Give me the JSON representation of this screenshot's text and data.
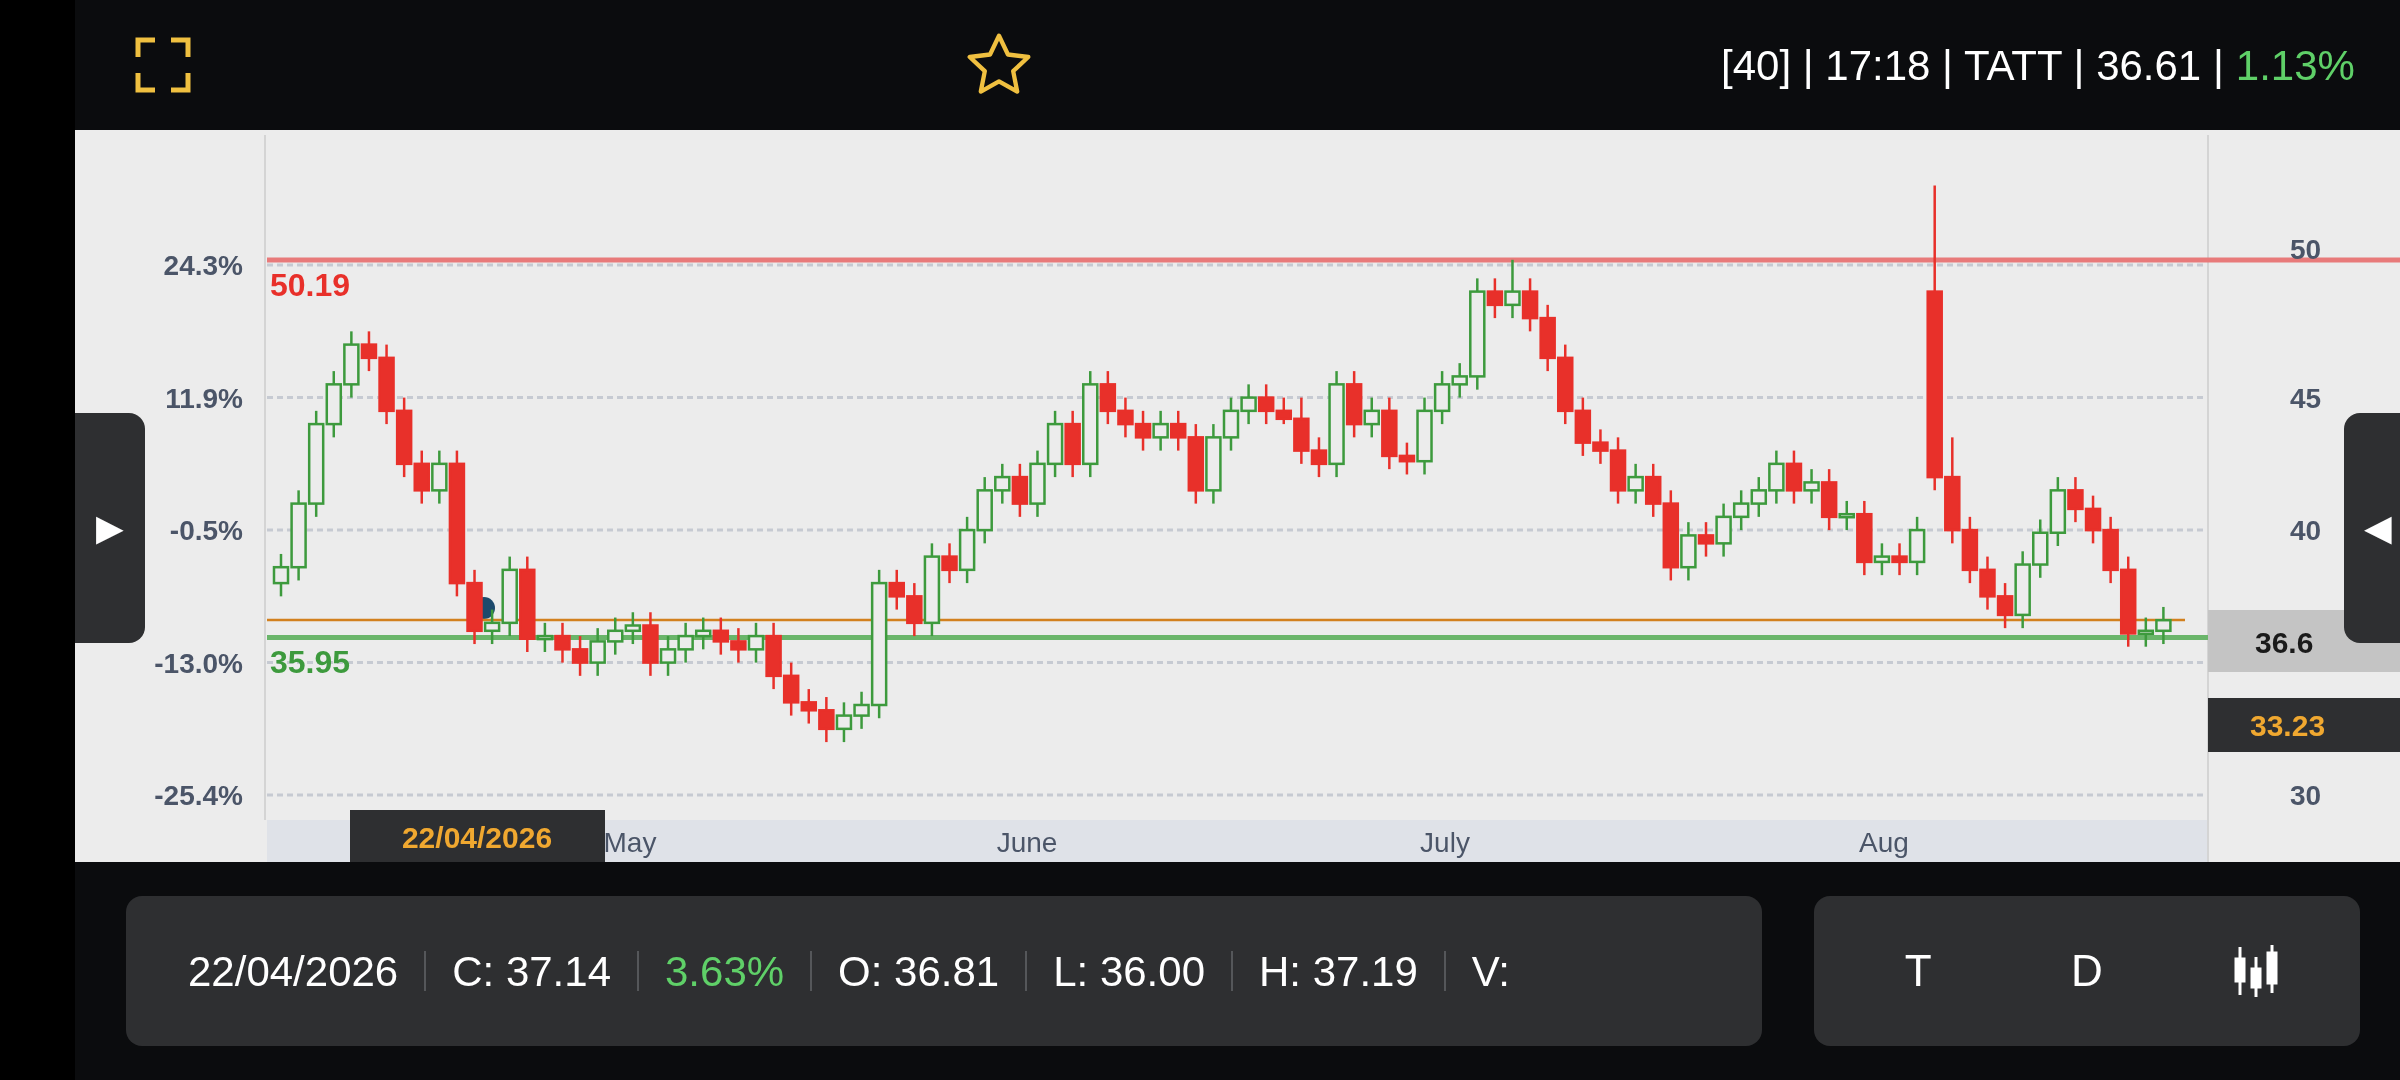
{
  "header": {
    "quote": "[40] | 17:18 | TATT | 36.61 |",
    "change": "1.13%"
  },
  "chart": {
    "left_axis": [
      "24.3%",
      "11.9%",
      "-0.5%",
      "-13.0%",
      "-25.4%"
    ],
    "right_axis": [
      "50",
      "45",
      "40",
      "30"
    ],
    "months": [
      "May",
      "June",
      "July",
      "Aug"
    ],
    "price_tag": "36.6",
    "marker_tag": "33.23",
    "cursor_date": "22/04/2026",
    "left_handle": "▶",
    "right_handle": "◀",
    "chart_data": {
      "type": "candlestick",
      "ylim": [
        29.06,
        54.91
      ],
      "yticks": [
        50,
        45,
        40,
        30
      ],
      "grid": true,
      "ref_lines": [
        {
          "axis": "y",
          "value": 50.19,
          "label": "50.19",
          "color": "#e87a7a"
        },
        {
          "axis": "y",
          "value": 36.61,
          "color": "#d2801e"
        },
        {
          "axis": "y",
          "value": 35.95,
          "label": "35.95",
          "color": "#6ab56a"
        }
      ],
      "ohlc": [
        [
          38,
          39.1,
          37.5,
          38.6
        ],
        [
          38.6,
          41.5,
          38.1,
          41
        ],
        [
          41,
          44.5,
          40.5,
          44
        ],
        [
          44,
          46,
          43.5,
          45.5
        ],
        [
          45.5,
          47.5,
          45,
          47
        ],
        [
          47,
          47.5,
          46,
          46.5
        ],
        [
          46.5,
          47,
          44,
          44.5
        ],
        [
          44.5,
          45,
          42,
          42.5
        ],
        [
          42.5,
          43,
          41,
          41.5
        ],
        [
          41.5,
          43,
          41,
          42.5
        ],
        [
          42.5,
          43,
          37.5,
          38
        ],
        [
          38,
          38.5,
          35.7,
          36.2
        ],
        [
          36.2,
          37,
          35.7,
          36.5
        ],
        [
          36.5,
          39,
          36,
          38.5
        ],
        [
          38.5,
          39,
          35.4,
          35.9
        ],
        [
          35.9,
          36.5,
          35.4,
          36
        ],
        [
          36,
          36.5,
          35,
          35.5
        ],
        [
          35.5,
          36,
          34.5,
          35
        ],
        [
          35,
          36.3,
          34.5,
          35.8
        ],
        [
          35.8,
          36.7,
          35.3,
          36.2
        ],
        [
          36.2,
          36.9,
          35.7,
          36.4
        ],
        [
          36.4,
          36.9,
          34.5,
          35
        ],
        [
          35,
          36,
          34.5,
          35.5
        ],
        [
          35.5,
          36.5,
          35,
          36
        ],
        [
          36,
          36.7,
          35.5,
          36.2
        ],
        [
          36.2,
          36.7,
          35.3,
          35.8
        ],
        [
          35.8,
          36.3,
          35,
          35.5
        ],
        [
          35.5,
          36.5,
          35,
          36
        ],
        [
          36,
          36.5,
          34,
          34.5
        ],
        [
          34.5,
          35,
          33,
          33.5
        ],
        [
          33.5,
          34,
          32.7,
          33.2
        ],
        [
          33.2,
          33.7,
          32,
          32.5
        ],
        [
          32.5,
          33.5,
          32,
          33
        ],
        [
          33,
          33.9,
          32.5,
          33.4
        ],
        [
          33.4,
          38.5,
          32.9,
          38
        ],
        [
          38,
          38.5,
          37,
          37.5
        ],
        [
          37.5,
          38,
          36,
          36.5
        ],
        [
          36.5,
          39.5,
          36,
          39
        ],
        [
          39,
          39.5,
          38,
          38.5
        ],
        [
          38.5,
          40.5,
          38,
          40
        ],
        [
          40,
          42,
          39.5,
          41.5
        ],
        [
          41.5,
          42.5,
          41,
          42
        ],
        [
          42,
          42.5,
          40.5,
          41
        ],
        [
          41,
          43,
          40.5,
          42.5
        ],
        [
          42.5,
          44.5,
          42,
          44
        ],
        [
          44,
          44.5,
          42,
          42.5
        ],
        [
          42.5,
          46,
          42,
          45.5
        ],
        [
          45.5,
          46,
          44,
          44.5
        ],
        [
          44.5,
          45,
          43.5,
          44
        ],
        [
          44,
          44.5,
          43,
          43.5
        ],
        [
          43.5,
          44.5,
          43,
          44
        ],
        [
          44,
          44.5,
          43,
          43.5
        ],
        [
          43.5,
          44,
          41,
          41.5
        ],
        [
          41.5,
          44,
          41,
          43.5
        ],
        [
          43.5,
          45,
          43,
          44.5
        ],
        [
          44.5,
          45.5,
          44,
          45
        ],
        [
          45,
          45.5,
          44,
          44.5
        ],
        [
          44.5,
          45,
          44,
          44.2
        ],
        [
          44.2,
          45,
          42.5,
          43
        ],
        [
          43,
          43.5,
          42,
          42.5
        ],
        [
          42.5,
          46,
          42,
          45.5
        ],
        [
          45.5,
          46,
          43.5,
          44
        ],
        [
          44,
          45,
          43.5,
          44.5
        ],
        [
          44.5,
          45,
          42.3,
          42.8
        ],
        [
          42.8,
          43.3,
          42.1,
          42.6
        ],
        [
          42.6,
          45,
          42.1,
          44.5
        ],
        [
          44.5,
          46,
          44,
          45.5
        ],
        [
          45.5,
          46.3,
          45,
          45.8
        ],
        [
          45.8,
          49.5,
          45.3,
          49
        ],
        [
          49,
          49.5,
          48,
          48.5
        ],
        [
          48.5,
          50.2,
          48,
          49
        ],
        [
          49,
          49.5,
          47.5,
          48
        ],
        [
          48,
          48.5,
          46,
          46.5
        ],
        [
          46.5,
          47,
          44,
          44.5
        ],
        [
          44.5,
          45,
          42.8,
          43.3
        ],
        [
          43.3,
          43.8,
          42.5,
          43
        ],
        [
          43,
          43.5,
          41,
          41.5
        ],
        [
          41.5,
          42.5,
          41,
          42
        ],
        [
          42,
          42.5,
          40.5,
          41
        ],
        [
          41,
          41.5,
          38.1,
          38.6
        ],
        [
          38.6,
          40.3,
          38.1,
          39.8
        ],
        [
          39.8,
          40.3,
          39,
          39.5
        ],
        [
          39.5,
          41,
          39,
          40.5
        ],
        [
          40.5,
          41.5,
          40,
          41
        ],
        [
          41,
          42,
          40.5,
          41.5
        ],
        [
          41.5,
          43,
          41,
          42.5
        ],
        [
          42.5,
          43,
          41,
          41.5
        ],
        [
          41.5,
          42.3,
          41,
          41.8
        ],
        [
          41.8,
          42.3,
          40,
          40.5
        ],
        [
          40.5,
          41.1,
          40,
          40.6
        ],
        [
          40.6,
          41.1,
          38.3,
          38.8
        ],
        [
          38.8,
          39.5,
          38.3,
          39
        ],
        [
          39,
          39.5,
          38.3,
          38.8
        ],
        [
          38.8,
          40.5,
          38.3,
          40
        ],
        [
          49,
          53,
          41.5,
          42
        ],
        [
          42,
          43.5,
          39.5,
          40
        ],
        [
          40,
          40.5,
          38,
          38.5
        ],
        [
          38.5,
          39,
          37,
          37.5
        ],
        [
          37.5,
          38,
          36.3,
          36.8
        ],
        [
          36.8,
          39.2,
          36.3,
          38.7
        ],
        [
          38.7,
          40.4,
          38.2,
          39.9
        ],
        [
          39.9,
          42,
          39.4,
          41.5
        ],
        [
          41.5,
          42,
          40.3,
          40.8
        ],
        [
          40.8,
          41.3,
          39.5,
          40
        ],
        [
          40,
          40.5,
          38,
          38.5
        ],
        [
          38.5,
          39,
          35.6,
          36.1
        ],
        [
          36.1,
          36.7,
          35.6,
          36.2
        ],
        [
          36.2,
          37.1,
          35.7,
          36.6
        ]
      ]
    }
  },
  "info_bar": [
    {
      "kind": "value",
      "text": "22/04/2026"
    },
    {
      "kind": "value",
      "text": "C: 37.14"
    },
    {
      "kind": "change",
      "text": "3.63%"
    },
    {
      "kind": "value",
      "text": "O: 36.81"
    },
    {
      "kind": "value",
      "text": "L: 36.00"
    },
    {
      "kind": "value",
      "text": "H: 37.19"
    },
    {
      "kind": "value",
      "text": "V:"
    }
  ],
  "buttons": [
    {
      "kind": "text",
      "label": "T"
    },
    {
      "kind": "text",
      "label": "D"
    },
    {
      "kind": "candles"
    }
  ]
}
